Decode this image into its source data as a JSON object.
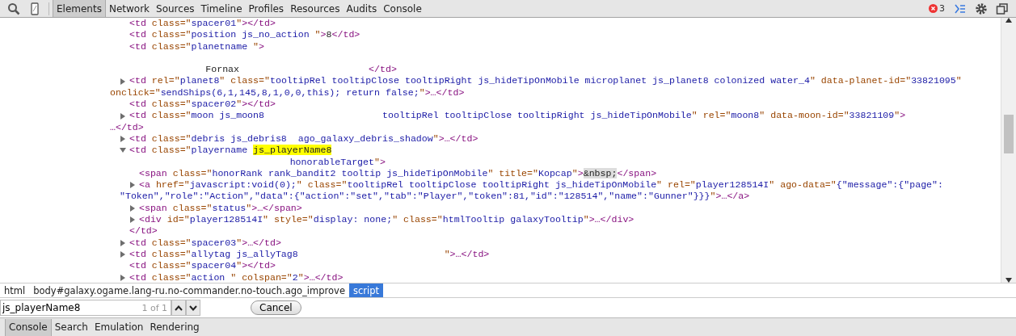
{
  "toolbar": {
    "tabs": [
      {
        "label": "Elements",
        "selected": true
      },
      {
        "label": "Network",
        "selected": false
      },
      {
        "label": "Sources",
        "selected": false
      },
      {
        "label": "Timeline",
        "selected": false
      },
      {
        "label": "Profiles",
        "selected": false
      },
      {
        "label": "Resources",
        "selected": false
      },
      {
        "label": "Audits",
        "selected": false
      },
      {
        "label": "Console",
        "selected": false
      }
    ],
    "error_count": "3"
  },
  "dom_tree": [
    {
      "lines": [
        [
          {
            "kind": "tag",
            "text": "<td "
          },
          {
            "kind": "attr",
            "text": "class=\""
          },
          {
            "kind": "val",
            "text": "spacer01"
          },
          {
            "kind": "attr",
            "text": "\""
          },
          {
            "kind": "tag",
            "text": "></td>"
          }
        ]
      ]
    },
    {
      "lines": [
        [
          {
            "kind": "tag",
            "text": "<td "
          },
          {
            "kind": "attr",
            "text": "class=\""
          },
          {
            "kind": "val",
            "text": "position js_no_action "
          },
          {
            "kind": "attr",
            "text": "\""
          },
          {
            "kind": "tag",
            "text": ">"
          },
          {
            "kind": "text",
            "text": "8"
          },
          {
            "kind": "tag",
            "text": "</td>"
          }
        ]
      ]
    },
    {
      "lines": [
        [
          {
            "kind": "tag",
            "text": "<td "
          },
          {
            "kind": "attr",
            "text": "class=\""
          },
          {
            "kind": "val",
            "text": "planetname "
          },
          {
            "kind": "attr",
            "text": "\""
          },
          {
            "kind": "tag",
            "text": ">"
          }
        ],
        [
          {
            "kind": "text",
            "text": "\n                 Fornax                       "
          },
          {
            "kind": "tag",
            "text": "</td>"
          }
        ]
      ]
    },
    {
      "expanded": false,
      "lines": [
        [
          {
            "kind": "tag",
            "text": "<td "
          },
          {
            "kind": "attr",
            "text": "rel=\""
          },
          {
            "kind": "val",
            "text": "planet8"
          },
          {
            "kind": "attr",
            "text": "\" class=\""
          },
          {
            "kind": "val",
            "text": "tooltipRel tooltipClose tooltipRight js_hideTipOnMobile microplanet js_planet8 colonized water_4"
          },
          {
            "kind": "attr",
            "text": "\" data-planet-id=\""
          },
          {
            "kind": "val",
            "text": "33821095"
          },
          {
            "kind": "attr",
            "text": "\""
          }
        ],
        [
          {
            "kind": "attr",
            "text": "onclick=\""
          },
          {
            "kind": "val",
            "text": "sendShips(6,1,145,8,1,0,0,this); return false;"
          },
          {
            "kind": "attr",
            "text": "\""
          },
          {
            "kind": "tag",
            "text": ">…</td>"
          }
        ]
      ]
    },
    {
      "lines": [
        [
          {
            "kind": "tag",
            "text": "<td "
          },
          {
            "kind": "attr",
            "text": "class=\""
          },
          {
            "kind": "val",
            "text": "spacer02"
          },
          {
            "kind": "attr",
            "text": "\""
          },
          {
            "kind": "tag",
            "text": "></td>"
          }
        ]
      ]
    },
    {
      "expanded": false,
      "lines": [
        [
          {
            "kind": "tag",
            "text": "<td "
          },
          {
            "kind": "attr",
            "text": "class=\""
          },
          {
            "kind": "val",
            "text": "moon js_moon8                     tooltipRel tooltipClose tooltipRight js_hideTipOnMobile"
          },
          {
            "kind": "attr",
            "text": "\" rel=\""
          },
          {
            "kind": "val",
            "text": "moon8"
          },
          {
            "kind": "attr",
            "text": "\" data-moon-id=\""
          },
          {
            "kind": "val",
            "text": "33821109"
          },
          {
            "kind": "attr",
            "text": "\""
          },
          {
            "kind": "tag",
            "text": ">"
          }
        ],
        [
          {
            "kind": "tag",
            "text": "…</td>"
          }
        ]
      ]
    },
    {
      "expanded": false,
      "lines": [
        [
          {
            "kind": "tag",
            "text": "<td "
          },
          {
            "kind": "attr",
            "text": "class=\""
          },
          {
            "kind": "val",
            "text": "debris js_debris8  ago_galaxy_debris_shadow"
          },
          {
            "kind": "attr",
            "text": "\""
          },
          {
            "kind": "tag",
            "text": ">…</td>"
          }
        ]
      ]
    },
    {
      "expanded": true,
      "lines": [
        [
          {
            "kind": "tag",
            "text": "<td "
          },
          {
            "kind": "attr",
            "text": "class=\""
          },
          {
            "kind": "val",
            "text": "playername "
          },
          {
            "kind": "match",
            "text": "js_playerName8"
          }
        ],
        [
          {
            "kind": "val",
            "text": "                                honorableTarget"
          },
          {
            "kind": "attr",
            "text": "\""
          },
          {
            "kind": "tag",
            "text": ">"
          }
        ]
      ],
      "children": [
        {
          "lines": [
            [
              {
                "kind": "tag",
                "text": "<span "
              },
              {
                "kind": "attr",
                "text": "class=\""
              },
              {
                "kind": "val",
                "text": "honorRank rank_bandit2 tooltip js_hideTipOnMobile"
              },
              {
                "kind": "attr",
                "text": "\" title=\""
              },
              {
                "kind": "val",
                "text": "Kopcap"
              },
              {
                "kind": "attr",
                "text": "\""
              },
              {
                "kind": "tag",
                "text": ">"
              },
              {
                "kind": "entity",
                "text": "&nbsp;"
              },
              {
                "kind": "tag",
                "text": "</span>"
              }
            ]
          ]
        },
        {
          "expanded": false,
          "lines": [
            [
              {
                "kind": "tag",
                "text": "<a "
              },
              {
                "kind": "attr",
                "text": "href=\""
              },
              {
                "kind": "val",
                "text": "javascript:void(0);"
              },
              {
                "kind": "attr",
                "text": "\" class=\""
              },
              {
                "kind": "val",
                "text": "tooltipRel tooltipClose tooltipRight js_hideTipOnMobile"
              },
              {
                "kind": "attr",
                "text": "\" rel=\""
              },
              {
                "kind": "val",
                "text": "player128514I"
              },
              {
                "kind": "attr",
                "text": "\" ago-data=\""
              },
              {
                "kind": "val",
                "text": "{\"message\":{\"page\":"
              }
            ],
            [
              {
                "kind": "val",
                "text": "\"Token\",\"role\":\"Action\",\"data\":{\"action\":\"set\",\"tab\":\"Player\",\"token\":81,\"id\":\"128514\",\"name\":\"Gunner\"}}}"
              },
              {
                "kind": "attr",
                "text": "\""
              },
              {
                "kind": "tag",
                "text": ">…</a>"
              }
            ]
          ]
        },
        {
          "expanded": false,
          "lines": [
            [
              {
                "kind": "tag",
                "text": "<span "
              },
              {
                "kind": "attr",
                "text": "class=\""
              },
              {
                "kind": "val",
                "text": "status"
              },
              {
                "kind": "attr",
                "text": "\""
              },
              {
                "kind": "tag",
                "text": ">…</span>"
              }
            ]
          ]
        },
        {
          "expanded": false,
          "lines": [
            [
              {
                "kind": "tag",
                "text": "<div "
              },
              {
                "kind": "attr",
                "text": "id=\""
              },
              {
                "kind": "val",
                "text": "player128514I"
              },
              {
                "kind": "attr",
                "text": "\" style=\""
              },
              {
                "kind": "val",
                "text": "display: none;"
              },
              {
                "kind": "attr",
                "text": "\" class=\""
              },
              {
                "kind": "val",
                "text": "htmlTooltip galaxyTooltip"
              },
              {
                "kind": "attr",
                "text": "\""
              },
              {
                "kind": "tag",
                "text": ">…</div>"
              }
            ]
          ]
        }
      ],
      "close": [
        {
          "kind": "tag",
          "text": "</td>"
        }
      ]
    },
    {
      "expanded": false,
      "lines": [
        [
          {
            "kind": "tag",
            "text": "<td "
          },
          {
            "kind": "attr",
            "text": "class=\""
          },
          {
            "kind": "val",
            "text": "spacer03"
          },
          {
            "kind": "attr",
            "text": "\""
          },
          {
            "kind": "tag",
            "text": ">…</td>"
          }
        ]
      ]
    },
    {
      "expanded": false,
      "lines": [
        [
          {
            "kind": "tag",
            "text": "<td "
          },
          {
            "kind": "attr",
            "text": "class=\""
          },
          {
            "kind": "val",
            "text": "allytag js_allyTag8                          "
          },
          {
            "kind": "attr",
            "text": "\""
          },
          {
            "kind": "tag",
            "text": ">…</td>"
          }
        ]
      ]
    },
    {
      "lines": [
        [
          {
            "kind": "tag",
            "text": "<td "
          },
          {
            "kind": "attr",
            "text": "class=\""
          },
          {
            "kind": "val",
            "text": "spacer04"
          },
          {
            "kind": "attr",
            "text": "\""
          },
          {
            "kind": "tag",
            "text": "></td>"
          }
        ]
      ]
    },
    {
      "expanded": false,
      "lines": [
        [
          {
            "kind": "tag",
            "text": "<td "
          },
          {
            "kind": "attr",
            "text": "class=\""
          },
          {
            "kind": "val",
            "text": "action "
          },
          {
            "kind": "attr",
            "text": "\" colspan=\""
          },
          {
            "kind": "val",
            "text": "2"
          },
          {
            "kind": "attr",
            "text": "\""
          },
          {
            "kind": "tag",
            "text": ">…</td>"
          }
        ]
      ]
    }
  ],
  "breadcrumbs": [
    {
      "label": "html",
      "selected": false
    },
    {
      "label": "body#galaxy.ogame.lang-ru.no-commander.no-touch.ago_improve",
      "selected": false
    },
    {
      "label": "script",
      "selected": true
    }
  ],
  "find_bar": {
    "value": "js_playerName8",
    "count": "1 of 1",
    "cancel": "Cancel"
  },
  "drawer_tabs": [
    {
      "label": "Console",
      "selected": true
    },
    {
      "label": "Search",
      "selected": false
    },
    {
      "label": "Emulation",
      "selected": false
    },
    {
      "label": "Rendering",
      "selected": false
    }
  ]
}
